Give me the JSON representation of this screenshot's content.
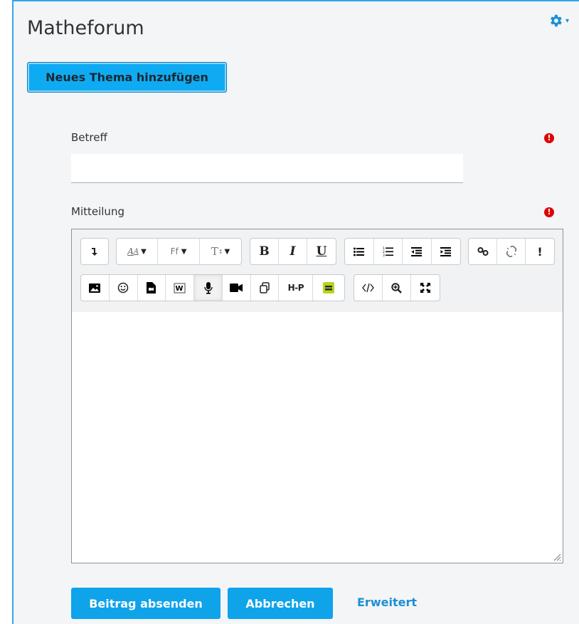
{
  "forum": {
    "title": "Matheforum"
  },
  "actions": {
    "new_topic_label": "Neues Thema hinzufügen"
  },
  "form": {
    "subject": {
      "label": "Betreff",
      "value": "",
      "required_icon": "!"
    },
    "message": {
      "label": "Mitteilung",
      "required_icon": "!"
    }
  },
  "toolbar": {
    "row1": {
      "format_text": "A",
      "font_family": "Ff",
      "font_size": "T",
      "bold": "B",
      "italic": "I",
      "underline": "U",
      "accessibility": "!"
    },
    "row2": {
      "h5p": "H-P"
    }
  },
  "footer": {
    "submit_label": "Beitrag absenden",
    "cancel_label": "Abbrechen",
    "advanced_label": "Erweitert"
  },
  "colors": {
    "accent": "#0fa3ea",
    "required": "#e00000",
    "link": "#1c8fd3"
  }
}
